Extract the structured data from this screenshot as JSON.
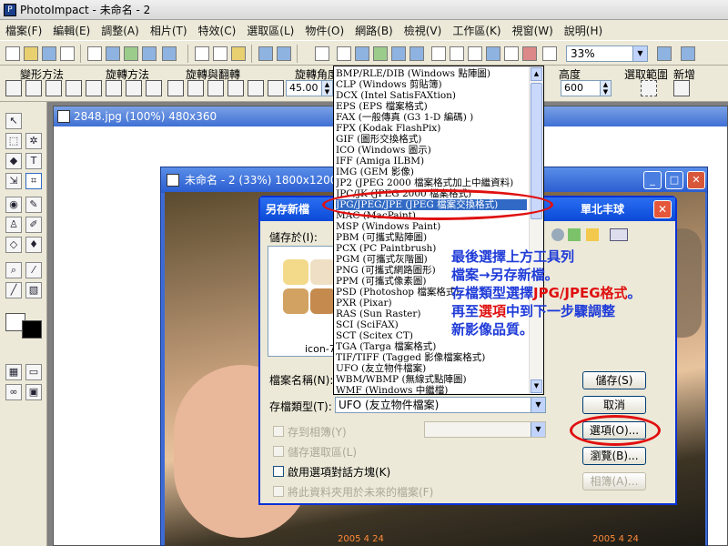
{
  "app": {
    "title": "PhotoImpact - 未命名 - 2"
  },
  "menu": [
    "檔案(F)",
    "編輯(E)",
    "調整(A)",
    "相片(T)",
    "特效(C)",
    "選取區(L)",
    "物件(O)",
    "網路(B)",
    "檢視(V)",
    "工作區(K)",
    "視窗(W)",
    "說明(H)"
  ],
  "toolbar": {
    "zoom": "33%"
  },
  "toolbar2": {
    "labels": [
      "變形方法",
      "旋轉方法",
      "旋轉與翻轉",
      "旋轉角度",
      "高度",
      "選取範圍",
      "新增"
    ],
    "angle": "45.00",
    "height": "600"
  },
  "doc1": {
    "title": "2848.jpg (100%) 480x360"
  },
  "doc2": {
    "title": "未命名 - 2 (33%) 1800x1200"
  },
  "photo": {
    "date1": "2005 4 24",
    "date2": "2005 4 24"
  },
  "dialog": {
    "title": "另存新檔",
    "header_extra": "單北丰球",
    "save_in_label": "儲存於(I):",
    "thumb_label": "icon-7",
    "filename_label": "檔案名稱(N):",
    "filetype_label": "存檔類型(T):",
    "filetype_value": "UFO (友立物件檔案)",
    "save_to_album": "存到相簿(Y)",
    "save_selection": "儲存選取區(L)",
    "enable_options": "啟用選項對話方塊(K)",
    "future_default": "將此資料夾用於未來的檔案(F)",
    "buttons": {
      "save": "儲存(S)",
      "cancel": "取消",
      "options": "選項(O)...",
      "browse": "瀏覽(B)...",
      "album": "相簿(A)..."
    }
  },
  "filetypes": [
    "BMP/RLE/DIB (Windows 點陣圖)",
    "CLP (Windows 剪貼簿)",
    "DCX (Intel SatisFAXtion)",
    "EPS (EPS 檔案格式)",
    "FAX (一般傳真 (G3 1-D 編碼) )",
    "FPX (Kodak FlashPix)",
    "GIF (圖形交換格式)",
    "ICO (Windows 圖示)",
    "IFF (Amiga ILBM)",
    "IMG (GEM 影像)",
    "JP2 (JPEG 2000 檔案格式加上中繼資料)",
    "JPC/JK (JPEG 2000 檔案格式)",
    "JPG/JPEG/JPE (JPEG 檔案交換格式)",
    "MAC (MacPaint)",
    "MSP (Windows Paint)",
    "PBM (可攜式點陣圖)",
    "PCX (PC Paintbrush)",
    "PGM (可攜式灰階圖)",
    "PNG (可攜式網路圖形)",
    "PPM (可攜式像素圖)",
    "PSD (Photoshop 檔案格式)",
    "PXR (Pixar)",
    "RAS (Sun Raster)",
    "SCI (SciFAX)",
    "SCT (Scitex CT)",
    "TGA (Targa 檔案格式)",
    "TIF/TIFF (Tagged 影像檔案格式)",
    "UFO (友立物件檔案)",
    "WBM/WBMP (無線式點陣圖)",
    "WMF (Windows 中繼檔)"
  ],
  "selected_filetype_index": 12,
  "annotation": {
    "line1": "最後選擇上方工具列",
    "line2": "檔案→另存新檔。",
    "line3a": "存檔類型選擇",
    "line3b": "JPG/JPEG格式",
    "line3c": "。",
    "line4a": "再至",
    "line4b": "選項",
    "line4c": "中到下一步驟調整",
    "line5": "新影像品質。"
  },
  "colors": {
    "highlight": "#316ac5",
    "annotation_blue": "#1f3bd8",
    "annotation_red": "#e01010"
  }
}
